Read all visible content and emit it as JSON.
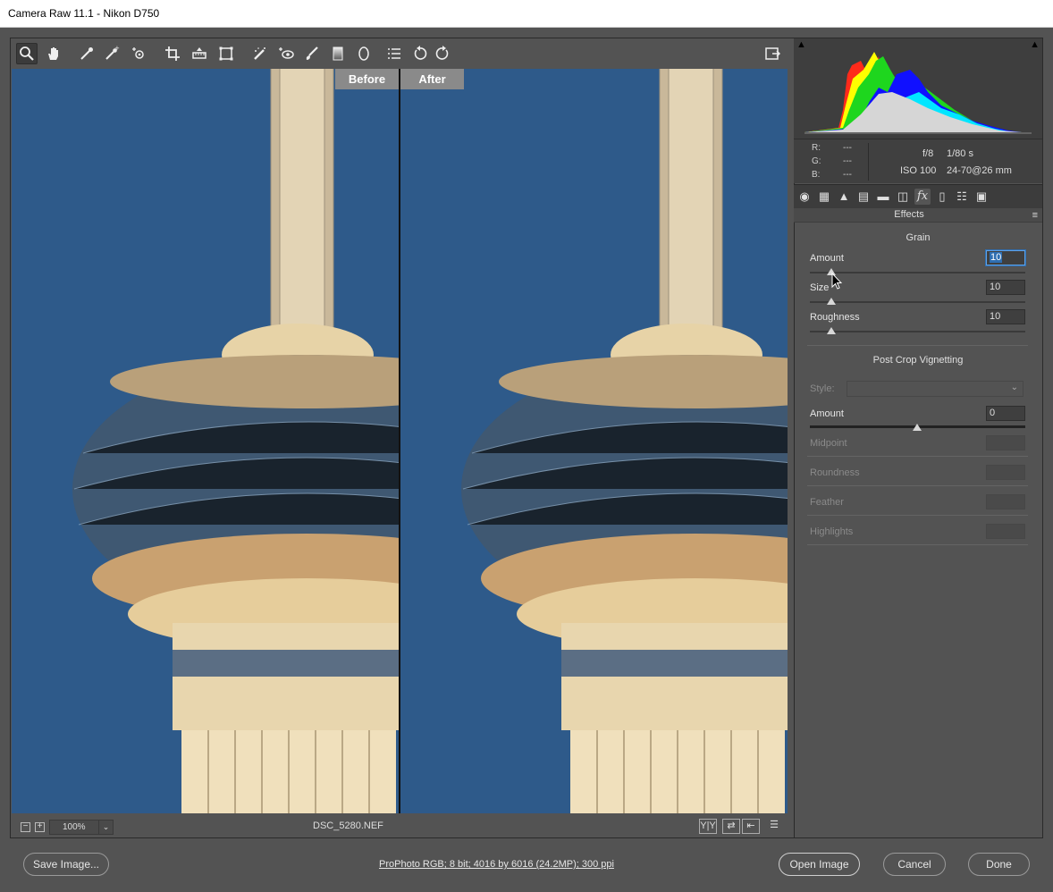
{
  "window": {
    "title": "Camera Raw 11.1  -  Nikon D750"
  },
  "toolbar": {
    "tools": [
      {
        "name": "zoom-tool",
        "glyph": "🔍"
      },
      {
        "name": "hand-tool",
        "glyph": "✋"
      },
      {
        "name": "white-balance-tool",
        "glyph": "✎"
      },
      {
        "name": "color-sampler-tool",
        "glyph": "✎"
      },
      {
        "name": "targeted-adjustment-tool",
        "glyph": "⊕"
      },
      {
        "name": "crop-tool",
        "glyph": "⌗"
      },
      {
        "name": "straighten-tool",
        "glyph": "▭"
      },
      {
        "name": "transform-tool",
        "glyph": "⬚"
      },
      {
        "name": "spot-removal-tool",
        "glyph": "✧"
      },
      {
        "name": "red-eye-tool",
        "glyph": "⊙"
      },
      {
        "name": "adjustment-brush-tool",
        "glyph": "✐"
      },
      {
        "name": "graduated-filter-tool",
        "glyph": "▮"
      },
      {
        "name": "radial-filter-tool",
        "glyph": "◯"
      },
      {
        "name": "preferences-tool",
        "glyph": "☰"
      },
      {
        "name": "rotate-left-tool",
        "glyph": "↺"
      },
      {
        "name": "rotate-right-tool",
        "glyph": "↻"
      }
    ],
    "fullscreen_glyph": "⇱"
  },
  "preview": {
    "before_label": "Before",
    "after_label": "After",
    "zoom_minus": "−",
    "zoom_plus": "+",
    "zoom_value": "100%",
    "zoom_arrow": "⌄",
    "filename": "DSC_5280.NEF",
    "view_buttons": [
      "Y|Y",
      "⇄",
      "⇤",
      "☰"
    ]
  },
  "histogram": {
    "shadow_clip_glyph": "▲",
    "highlight_clip_glyph": "▲"
  },
  "readout": {
    "r": "R:",
    "r_val": "---",
    "g": "G:",
    "g_val": "---",
    "b": "B:",
    "b_val": "---",
    "aperture": "f/8",
    "shutter": "1/80 s",
    "iso": "ISO 100",
    "lens": "24-70@26 mm"
  },
  "panel_tabs": [
    {
      "name": "basic-tab",
      "glyph": "◉"
    },
    {
      "name": "tone-curve-tab",
      "glyph": "▦"
    },
    {
      "name": "detail-tab",
      "glyph": "▲"
    },
    {
      "name": "hsl-tab",
      "glyph": "▤"
    },
    {
      "name": "split-toning-tab",
      "glyph": "▬"
    },
    {
      "name": "lens-corrections-tab",
      "glyph": "◫"
    },
    {
      "name": "effects-tab",
      "glyph": "fx"
    },
    {
      "name": "camera-calibration-tab",
      "glyph": "▯"
    },
    {
      "name": "presets-tab",
      "glyph": "☷"
    },
    {
      "name": "snapshots-tab",
      "glyph": "▣"
    }
  ],
  "panel": {
    "title": "Effects",
    "menu_glyph": "≡",
    "grain": {
      "title": "Grain",
      "amount_label": "Amount",
      "amount_value": "10",
      "size_label": "Size",
      "size_value": "10",
      "roughness_label": "Roughness",
      "roughness_value": "10"
    },
    "vignette": {
      "title": "Post Crop Vignetting",
      "style_label": "Style:",
      "style_value": "",
      "amount_label": "Amount",
      "amount_value": "0",
      "midpoint_label": "Midpoint",
      "roundness_label": "Roundness",
      "feather_label": "Feather",
      "highlights_label": "Highlights"
    }
  },
  "footer": {
    "save_label": "Save Image...",
    "workflow_info": "ProPhoto RGB; 8 bit; 4016 by 6016 (24.2MP); 300 ppi",
    "open_label": "Open Image",
    "cancel_label": "Cancel",
    "done_label": "Done"
  }
}
